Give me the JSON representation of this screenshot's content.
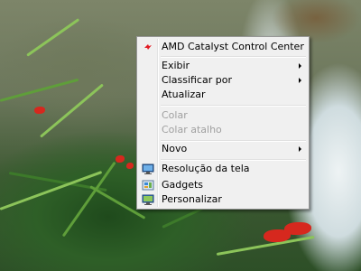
{
  "context_menu": {
    "amd_catalyst": {
      "label": "AMD Catalyst Control Center",
      "icon": "amd-catalyst-icon",
      "icon_color": "#e31b23"
    },
    "exibir": {
      "label": "Exibir",
      "has_submenu": true
    },
    "classificar_por": {
      "label": "Classificar por",
      "has_submenu": true
    },
    "atualizar": {
      "label": "Atualizar"
    },
    "colar": {
      "label": "Colar",
      "enabled": false
    },
    "colar_atalho": {
      "label": "Colar atalho",
      "enabled": false
    },
    "novo": {
      "label": "Novo",
      "has_submenu": true
    },
    "resolucao_da_tela": {
      "label": "Resolução da tela",
      "icon": "monitor-icon"
    },
    "gadgets": {
      "label": "Gadgets",
      "icon": "gadgets-icon"
    },
    "personalizar": {
      "label": "Personalizar",
      "icon": "personalize-icon"
    }
  },
  "colors": {
    "menu_background": "#f0f0f0",
    "menu_border": "#979797",
    "disabled_text": "#a0a0a0"
  }
}
